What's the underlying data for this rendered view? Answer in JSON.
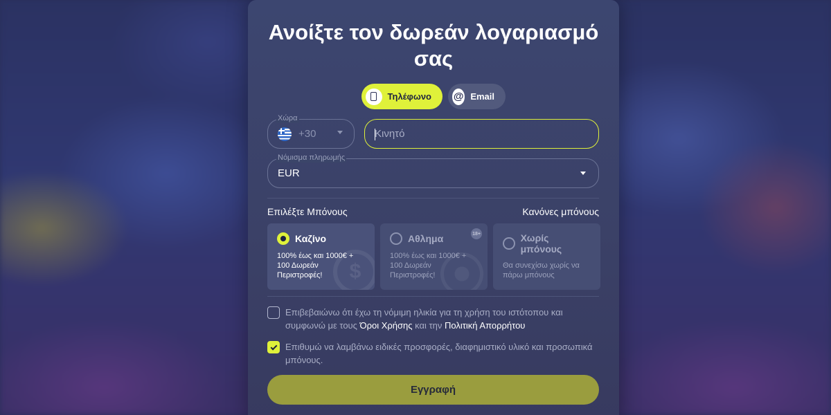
{
  "modal": {
    "title": "Ανοίξτε τον δωρεάν λογαριασμό σας"
  },
  "tabs": [
    {
      "label": "Τηλέφωνο",
      "icon": "phone-icon",
      "active": true
    },
    {
      "label": "Email",
      "icon": "at-icon",
      "active": false
    }
  ],
  "form": {
    "country_label": "Χώρα",
    "country_code": "+30",
    "country_flag": "greece-flag-icon",
    "mobile_placeholder": "Κινητό",
    "currency_label": "Νόμισμα πληρωμής",
    "currency_value": "EUR"
  },
  "bonus": {
    "heading": "Επιλέξτε Μπόνους",
    "rules_link": "Κανόνες μπόνους",
    "options": [
      {
        "title": "Καζίνο",
        "desc": "100% έως και 1000€ + 100 Δωρεάν Περιστροφές!",
        "selected": true,
        "badge": ""
      },
      {
        "title": "Αθλημα",
        "desc": "100% έως και 1000€ + 100 Δωρεάν Περιστροφές!",
        "selected": false,
        "badge": "18+"
      },
      {
        "title": "Χωρίς μπόνους",
        "desc": "Θα συνεχίσω χωρίς να πάρω μπόνους",
        "selected": false,
        "badge": ""
      }
    ]
  },
  "consent": {
    "age_text_1": "Επιβεβαιώνω ότι έχω τη νόμιμη ηλικία για τη χρήση του ιστότοπου και συμφωνώ με τους ",
    "terms_link": "Όροι Χρήσης",
    "age_text_2": " και την ",
    "privacy_link": "Πολιτική Απορρήτου",
    "age_checked": false,
    "marketing_text": "Επιθυμώ να λαμβάνω ειδικές προσφορές, διαφημιστικό υλικό και προσωπικά μπόνους.",
    "marketing_checked": true
  },
  "submit_label": "Εγγραφή",
  "colors": {
    "accent": "#dff13a",
    "modal_bg": "#3b4167",
    "submit_bg": "#9a9d3e"
  }
}
